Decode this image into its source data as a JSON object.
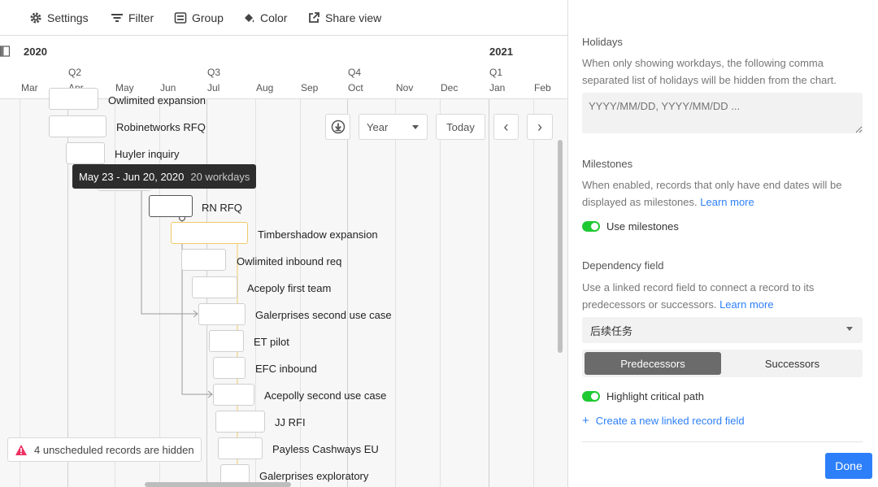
{
  "toolbar": {
    "settings": "Settings",
    "filter": "Filter",
    "group": "Group",
    "color": "Color",
    "share": "Share view"
  },
  "timeline": {
    "years": [
      "2020",
      "2021"
    ],
    "quarters": [
      "Q2",
      "Q3",
      "Q4",
      "Q1"
    ],
    "months": [
      "Mar",
      "Apr",
      "May",
      "Jun",
      "Jul",
      "Aug",
      "Sep",
      "Oct",
      "Nov",
      "Dec",
      "Jan",
      "Feb"
    ]
  },
  "controls": {
    "scale": "Year",
    "today": "Today",
    "prev": "‹",
    "next": "›"
  },
  "tooltip": {
    "range": "May 23 - Jun 20, 2020",
    "workdays": "20 workdays"
  },
  "records": [
    "Owlimited expansion",
    "Robinetworks RFQ",
    "Huyler inquiry",
    "RN RFQ",
    "Timbershadow expansion",
    "Owlimited inbound req",
    "Acepoly first team",
    "Galerprises second use case",
    "ET pilot",
    "EFC inbound",
    "Acepolly second use case",
    "JJ RFI",
    "Payless Cashways EU",
    "Galerprises exploratory"
  ],
  "warning": "4 unscheduled records are hidden",
  "panel": {
    "holidays_title": "Holidays",
    "holidays_desc": "When only showing workdays, the following comma separated list of holidays will be hidden from the chart.",
    "holidays_placeholder": "YYYY/MM/DD, YYYY/MM/DD ...",
    "milestones_title": "Milestones",
    "milestones_desc": "When enabled, records that only have end dates will be displayed as milestones.",
    "learn_more": "Learn more",
    "use_milestones": "Use milestones",
    "dependency_title": "Dependency field",
    "dependency_desc": "Use a linked record field to connect a record to its predecessors or successors.",
    "dependency_value": "后续任务",
    "predecessors": "Predecessors",
    "successors": "Successors",
    "highlight_critical": "Highlight critical path",
    "create_linked": "Create a new linked record field",
    "done": "Done"
  },
  "colors": {
    "accent": "#2d7ff9",
    "toggle_on": "#20c933",
    "critical": "#f0c96a"
  }
}
